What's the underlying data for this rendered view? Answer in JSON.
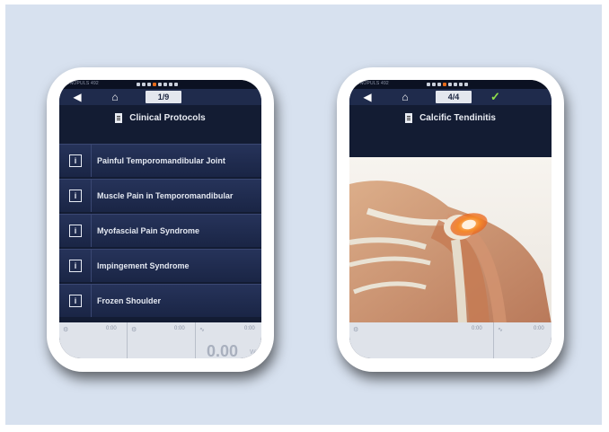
{
  "brand": "SONOPULS 492",
  "left_screen": {
    "page_indicator": "1/9",
    "title": "Clinical Protocols",
    "protocols": [
      "Painful Temporomandibular Joint",
      "Muscle Pain in Temporomandibular",
      "Myofascial Pain Syndrome",
      "Impingement Syndrome",
      "Frozen Shoulder"
    ],
    "info_icon_label": "i",
    "bottom": {
      "val1": "0:00",
      "val2": "0:00",
      "val3": "0:00",
      "big_value": "0.00",
      "unit": "W"
    }
  },
  "right_screen": {
    "page_indicator": "4/4",
    "title": "Calcific Tendinitis",
    "bottom": {
      "val1": "0:00",
      "val2": "0:00"
    }
  },
  "colors": {
    "background": "#d7e1ef",
    "screen": "#131c33",
    "accent": "#e66a1a",
    "check": "#8fe04a"
  }
}
